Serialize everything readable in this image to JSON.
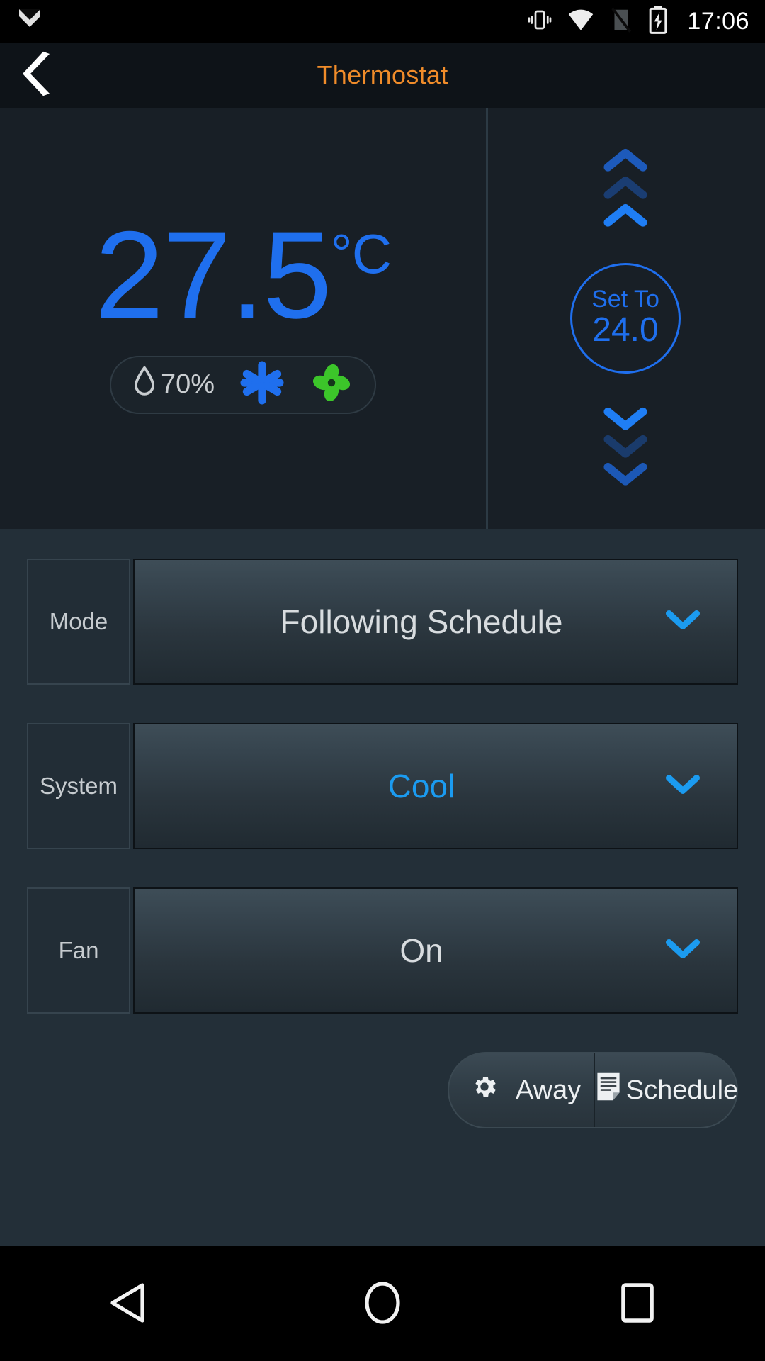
{
  "status_bar": {
    "icons": [
      "gmail-icon",
      "vibrate-icon",
      "wifi-icon",
      "sim-off-icon",
      "battery-charging-icon"
    ],
    "clock": "17:06"
  },
  "app_bar": {
    "back_icon": "back-chevron-icon",
    "title": "Thermostat",
    "title_color": "#f08c2a"
  },
  "hero": {
    "current_temperature": "27.5",
    "temperature_unit": "°C",
    "temperature_color": "#1f6fee",
    "humidity": {
      "icon": "water-drop-icon",
      "value": "70%"
    },
    "status_icons": [
      {
        "name": "snowflake-cooling-icon",
        "color": "#1f6fee"
      },
      {
        "name": "fan-running-icon",
        "color": "#3cc52a"
      }
    ],
    "increase_icon": "chevron-up-icon",
    "decrease_icon": "chevron-down-icon",
    "setpoint": {
      "label": "Set To",
      "value": "24.0",
      "color": "#1f6fee"
    }
  },
  "controls": [
    {
      "label": "Mode",
      "value": "Following Schedule",
      "accent": false,
      "chevron": "chevron-down-icon"
    },
    {
      "label": "System",
      "value": "Cool",
      "accent": true,
      "chevron": "chevron-down-icon"
    },
    {
      "label": "Fan",
      "value": "On",
      "accent": false,
      "chevron": "chevron-down-icon"
    }
  ],
  "actions": [
    {
      "label": "Away",
      "icon": "gear-icon"
    },
    {
      "label": "Schedule",
      "icon": "document-schedule-icon"
    }
  ],
  "nav_bar": {
    "back": "triangle-back-icon",
    "home": "circle-home-icon",
    "recents": "square-recents-icon"
  }
}
